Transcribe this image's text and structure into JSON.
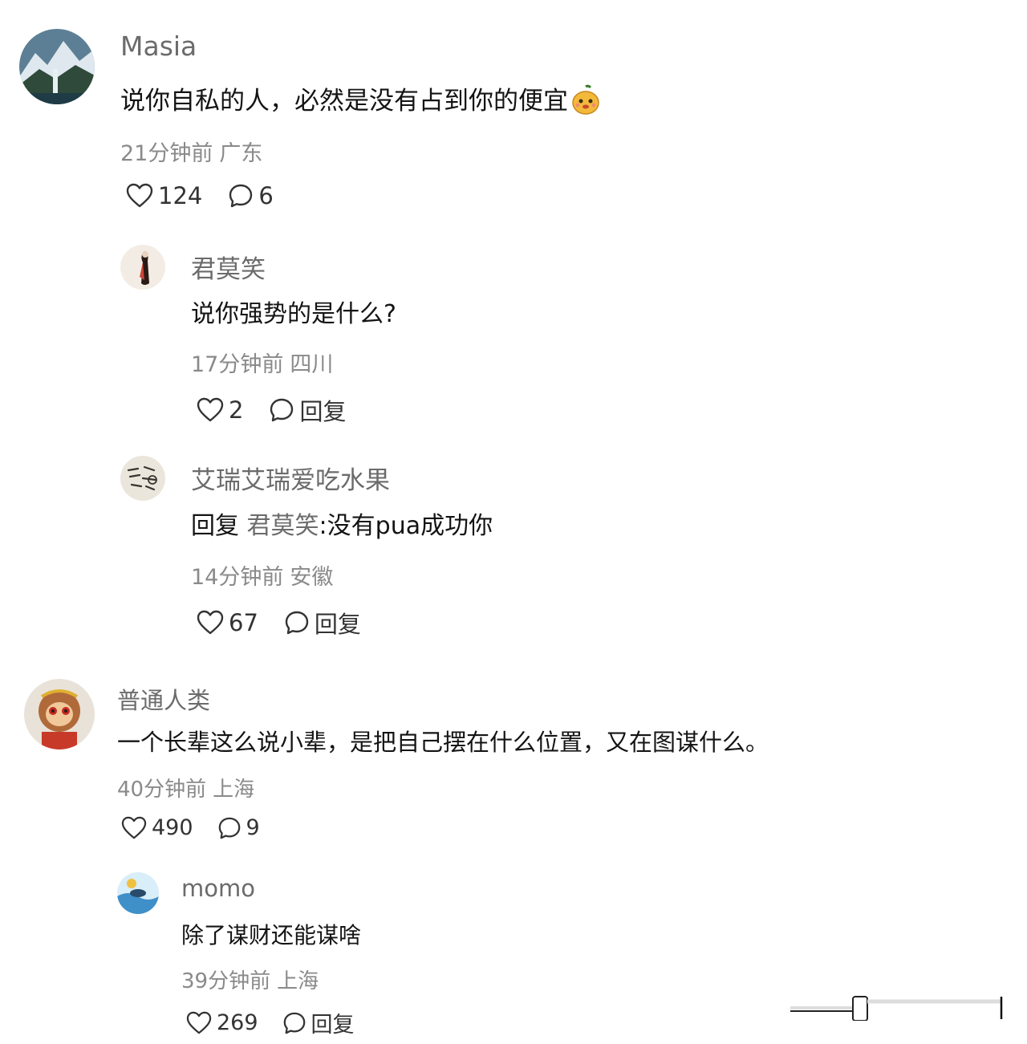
{
  "comments": [
    {
      "user": "Masia",
      "text": "说你自私的人，必然是没有占到你的便宜",
      "time": "21分钟前",
      "location": "广东",
      "likes": "124",
      "replies": "6"
    },
    {
      "user": "君莫笑",
      "text": "说你强势的是什么?",
      "time": "17分钟前",
      "location": "四川",
      "likes": "2",
      "reply_label": "回复"
    },
    {
      "user": "艾瑞艾瑞爱吃水果",
      "reply_prefix": "回复",
      "reply_target": "君莫笑",
      "text": ":没有pua成功你",
      "time": "14分钟前",
      "location": "安徽",
      "likes": "67",
      "reply_label": "回复"
    },
    {
      "user": "普通人类",
      "text": "一个长辈这么说小辈，是把自己摆在什么位置，又在图谋什么。",
      "time": "40分钟前",
      "location": "上海",
      "likes": "490",
      "replies": "9"
    },
    {
      "user": "momo",
      "text": "除了谋财还能谋啥",
      "time": "39分钟前",
      "location": "上海",
      "likes": "269",
      "reply_label": "回复"
    }
  ],
  "icons": {
    "like": "heart-outline-icon",
    "comment": "speech-bubble-icon",
    "emoji": "pear-face-emoji-icon"
  },
  "colors": {
    "username": "#6b6b6b",
    "body_text": "#141414",
    "meta": "#8a8a8a"
  }
}
